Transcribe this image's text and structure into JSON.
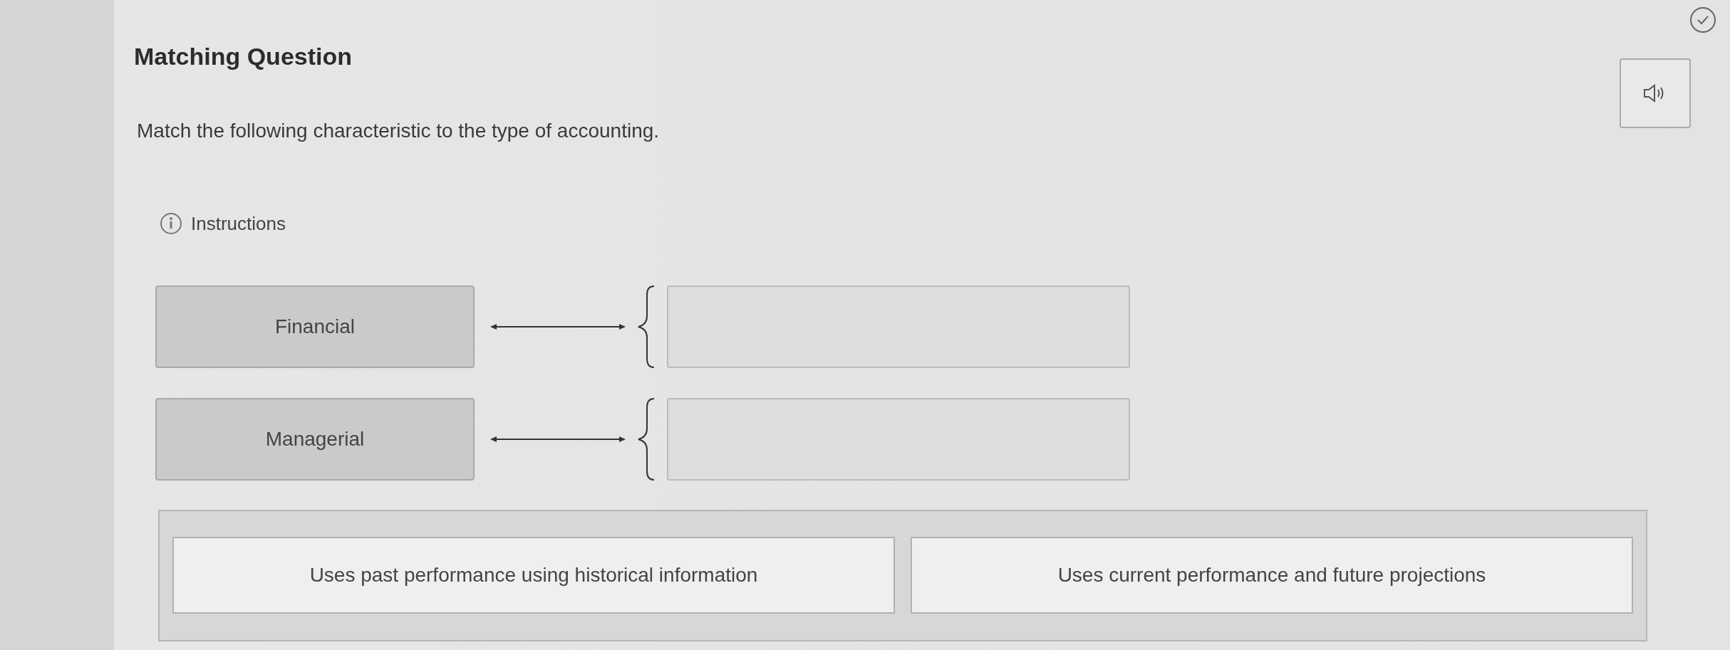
{
  "title": "Matching Question",
  "prompt": "Match the following characteristic to the type of accounting.",
  "instructions": "Instructions",
  "pairs": [
    {
      "label": "Financial"
    },
    {
      "label": "Managerial"
    }
  ],
  "choices": [
    "Uses past performance using historical information",
    "Uses current performance and future projections"
  ]
}
